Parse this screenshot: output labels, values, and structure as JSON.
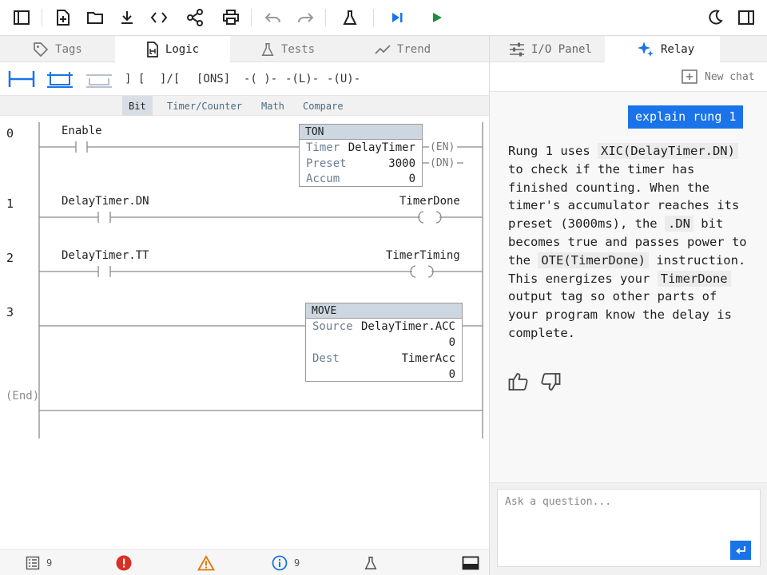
{
  "toolbar": {
    "icons": [
      "sidebar-icon",
      "new-file-icon",
      "folder-icon",
      "download-icon",
      "code-icon",
      "share-icon",
      "print-icon",
      "undo-icon",
      "redo-icon",
      "flask-icon",
      "step-icon",
      "run-icon",
      "dark-mode-icon",
      "panel-icon"
    ]
  },
  "left_tabs": [
    {
      "label": "Tags"
    },
    {
      "label": "Logic"
    },
    {
      "label": "Tests"
    },
    {
      "label": "Trend"
    }
  ],
  "palette": {
    "items": [
      "rung-icon",
      "branch-icon",
      "branch-level-icon"
    ],
    "xic": "] [",
    "xio": "]/[",
    "ons": "[ONS]",
    "ote": "-( )-",
    "otl": "-(L)-",
    "otu": "-(U)-"
  },
  "category_tabs": [
    "Bit",
    "Timer/Counter",
    "Math",
    "Compare"
  ],
  "ladder": {
    "rungs": [
      {
        "number": "0",
        "contact_tag": "Enable"
      },
      {
        "number": "1",
        "contact_tag": "DelayTimer.DN",
        "coil_tag": "TimerDone"
      },
      {
        "number": "2",
        "contact_tag": "DelayTimer.TT",
        "coil_tag": "TimerTiming"
      },
      {
        "number": "3"
      }
    ],
    "end_label": "(End)",
    "ton": {
      "title": "TON",
      "timer_label": "Timer",
      "timer_value": "DelayTimer",
      "preset_label": "Preset",
      "preset_value": "3000",
      "accum_label": "Accum",
      "accum_value": "0",
      "en": "(EN)",
      "dn": "(DN)"
    },
    "move": {
      "title": "MOVE",
      "source_label": "Source",
      "source_value": "DelayTimer.ACC",
      "source_num": "0",
      "dest_label": "Dest",
      "dest_value": "TimerAcc",
      "dest_num": "0"
    }
  },
  "status": {
    "list_count": "9",
    "info_count": "9"
  },
  "right_tabs": [
    {
      "label": "I/O Panel"
    },
    {
      "label": "Relay"
    }
  ],
  "chat": {
    "new_chat": "New chat",
    "user_message": "explain rung 1",
    "reply": {
      "p1": "Rung 1 uses ",
      "c1": "XIC(DelayTimer.DN)",
      "p2": " to check if the timer has finished counting. When the timer's accumulator reaches its preset (3000ms), the ",
      "c2": ".DN",
      "p3": " bit becomes true and passes power to the ",
      "c3": "OTE(TimerDone)",
      "p4": " instruction. This energizes your ",
      "c4": "TimerDone",
      "p5": " output tag so other parts of your program know the delay is complete."
    },
    "input_placeholder": "Ask a question..."
  },
  "colors": {
    "accent": "#1a73e8",
    "run": "#1e8e3e",
    "error": "#d93025",
    "warning": "#e37400",
    "info": "#1a73e8"
  }
}
